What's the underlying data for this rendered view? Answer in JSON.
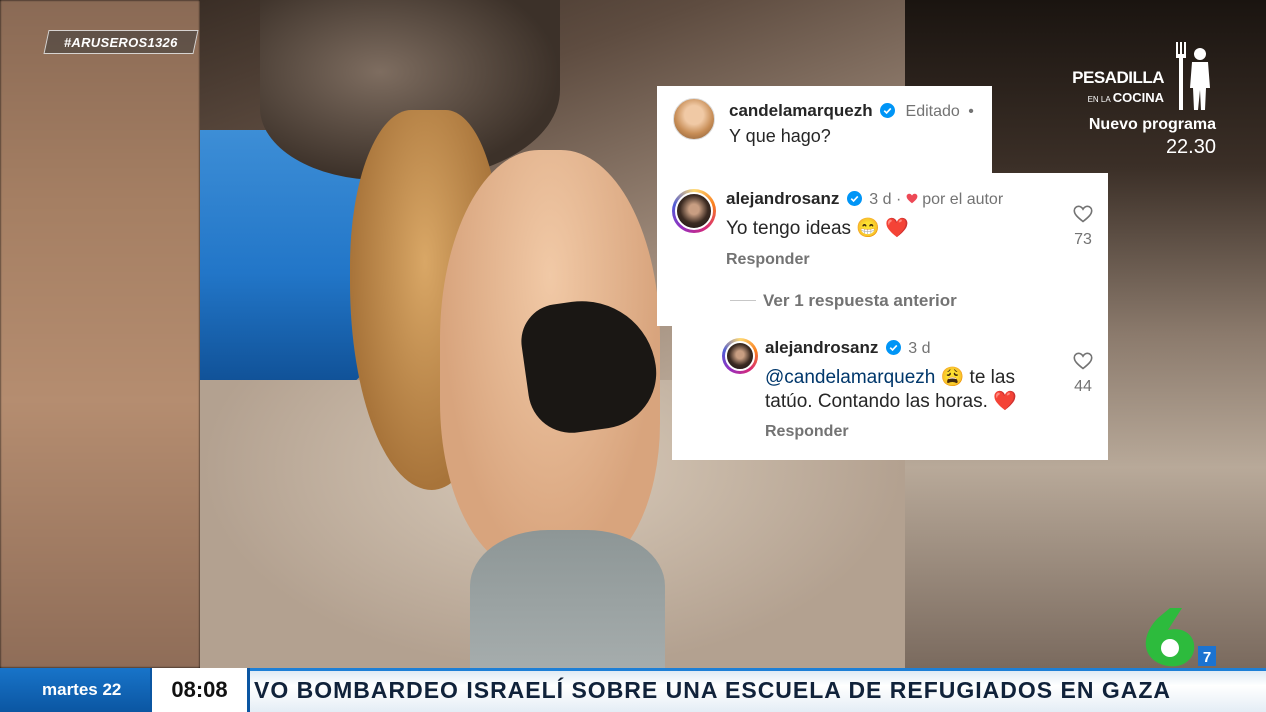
{
  "overlay": {
    "hashtag": "#ARUSEROS1326"
  },
  "promo": {
    "logo_line1": "PESADILLA",
    "logo_line2_prefix": "EN LA",
    "logo_line2": "COCINA",
    "subtitle": "Nuevo programa",
    "time": "22.30"
  },
  "post": {
    "username": "candelamarquezh",
    "edited": "Editado",
    "dot": "•",
    "caption": "Y que hago?"
  },
  "comment1": {
    "username": "alejandrosanz",
    "age": "3 d",
    "liked_by_author": "por el autor",
    "text": "Yo tengo ideas 😁 ❤️",
    "reply_label": "Responder",
    "likes": "73"
  },
  "view_replies": "Ver 1 respuesta anterior",
  "comment2": {
    "username": "alejandrosanz",
    "age": "3 d",
    "mention": "@candelamarquezh",
    "text_line1_rest": " 😩  te las",
    "text_line2": "tatúo. Contando las horas. ❤️",
    "reply_label": "Responder",
    "likes": "44"
  },
  "ticker": {
    "date": "martes 22",
    "time": "08:08",
    "headline": "VO BOMBARDEO ISRAELÍ SOBRE UNA ESCUELA DE REFUGIADOS EN GAZA"
  },
  "channel": {
    "number": "6",
    "badge": "7"
  },
  "colors": {
    "ticker_blue": "#0b56a2",
    "channel_green": "#2dbb3d",
    "ig_mention": "#00376b",
    "ig_verified": "#0095f6",
    "heart_red": "#ed4956"
  }
}
